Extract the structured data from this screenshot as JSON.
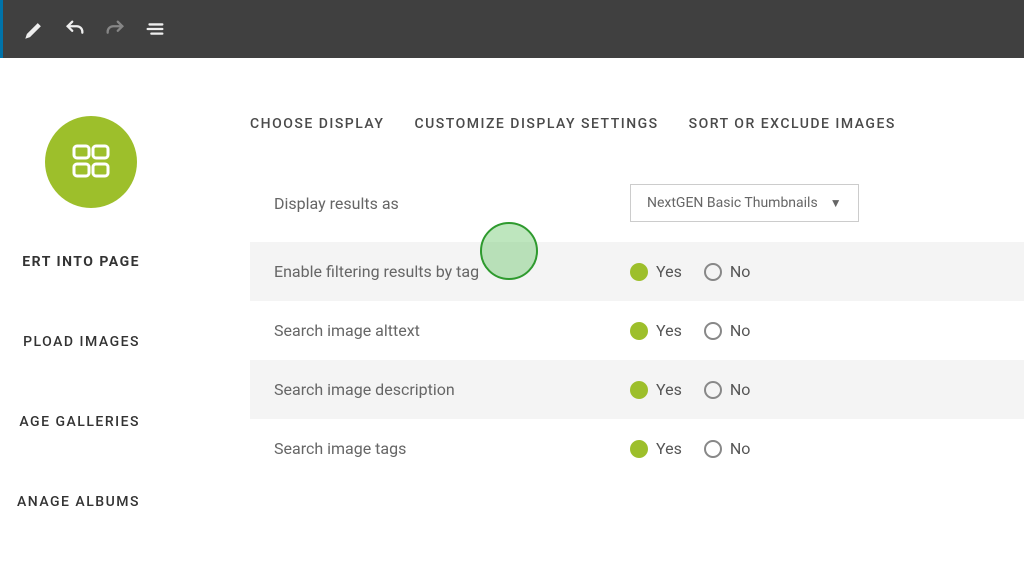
{
  "sidebar": {
    "items": [
      {
        "label": "ERT INTO PAGE"
      },
      {
        "label": "PLOAD IMAGES"
      },
      {
        "label": "AGE GALLERIES"
      },
      {
        "label": "ANAGE ALBUMS"
      }
    ]
  },
  "tabs": [
    {
      "label": "CHOOSE DISPLAY"
    },
    {
      "label": "CUSTOMIZE DISPLAY SETTINGS"
    },
    {
      "label": "SORT OR EXCLUDE IMAGES"
    }
  ],
  "settings": {
    "display_results": {
      "label": "Display results as",
      "value": "NextGEN Basic Thumbnails"
    },
    "enable_filtering": {
      "label": "Enable filtering results by tag",
      "yes": "Yes",
      "no": "No"
    },
    "search_alttext": {
      "label": "Search image alttext",
      "yes": "Yes",
      "no": "No"
    },
    "search_description": {
      "label": "Search image description",
      "yes": "Yes",
      "no": "No"
    },
    "search_tags": {
      "label": "Search image tags",
      "yes": "Yes",
      "no": "No"
    }
  }
}
